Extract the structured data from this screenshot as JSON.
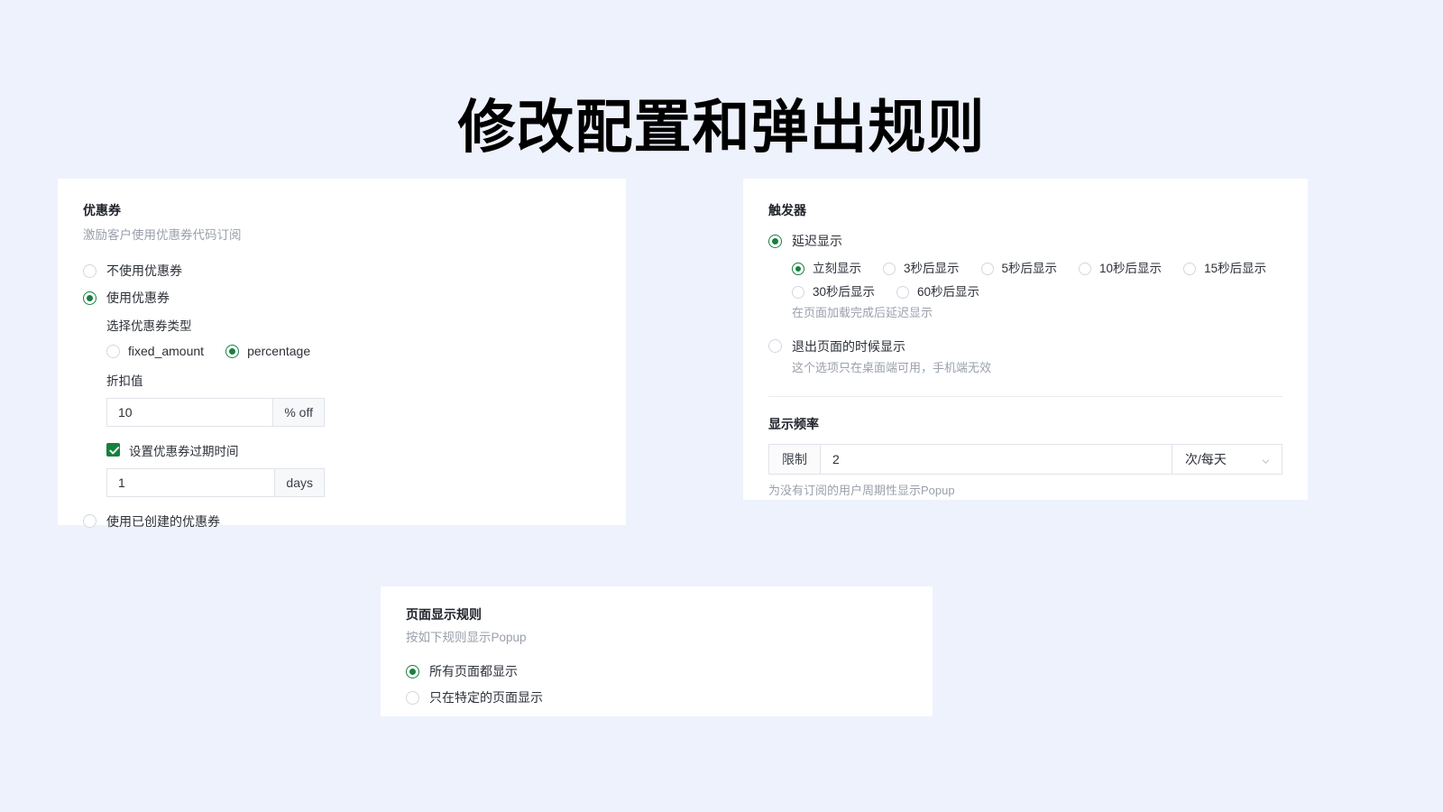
{
  "page": {
    "title": "修改配置和弹出规则",
    "background_color": "#eef2fc",
    "accent_color": "#17803f"
  },
  "coupon_card": {
    "title": "优惠券",
    "subtitle": "激励客户使用优惠券代码订阅",
    "options": [
      {
        "label": "不使用优惠券",
        "checked": false
      },
      {
        "label": "使用优惠券",
        "checked": true
      },
      {
        "label": "使用已创建的优惠券",
        "checked": false
      }
    ],
    "type_field": {
      "label": "选择优惠券类型",
      "options": [
        {
          "label": "fixed_amount",
          "checked": false
        },
        {
          "label": "percentage",
          "checked": true
        }
      ]
    },
    "discount_field": {
      "label": "折扣值",
      "value": "10",
      "suffix": "% off"
    },
    "expiry_checkbox": {
      "label": "设置优惠券过期时间",
      "checked": true
    },
    "expiry_field": {
      "value": "1",
      "suffix": "days"
    }
  },
  "trigger_card": {
    "title": "触发器",
    "delay_option": {
      "label": "延迟显示",
      "checked": true
    },
    "delay_choices": [
      {
        "label": "立刻显示",
        "checked": true
      },
      {
        "label": "3秒后显示",
        "checked": false
      },
      {
        "label": "5秒后显示",
        "checked": false
      },
      {
        "label": "10秒后显示",
        "checked": false
      },
      {
        "label": "15秒后显示",
        "checked": false
      },
      {
        "label": "30秒后显示",
        "checked": false
      },
      {
        "label": "60秒后显示",
        "checked": false
      }
    ],
    "delay_hint": "在页面加载完成后延迟显示",
    "exit_option": {
      "label": "退出页面的时候显示",
      "checked": false
    },
    "exit_hint": "这个选项只在桌面端可用，手机端无效",
    "frequency": {
      "title": "显示频率",
      "prefix": "限制",
      "value": "2",
      "unit": "次/每天",
      "hint": "为没有订阅的用户周期性显示Popup"
    }
  },
  "page_rules_card": {
    "title": "页面显示规则",
    "subtitle": "按如下规则显示Popup",
    "options": [
      {
        "label": "所有页面都显示",
        "checked": true
      },
      {
        "label": "只在特定的页面显示",
        "checked": false
      }
    ]
  }
}
